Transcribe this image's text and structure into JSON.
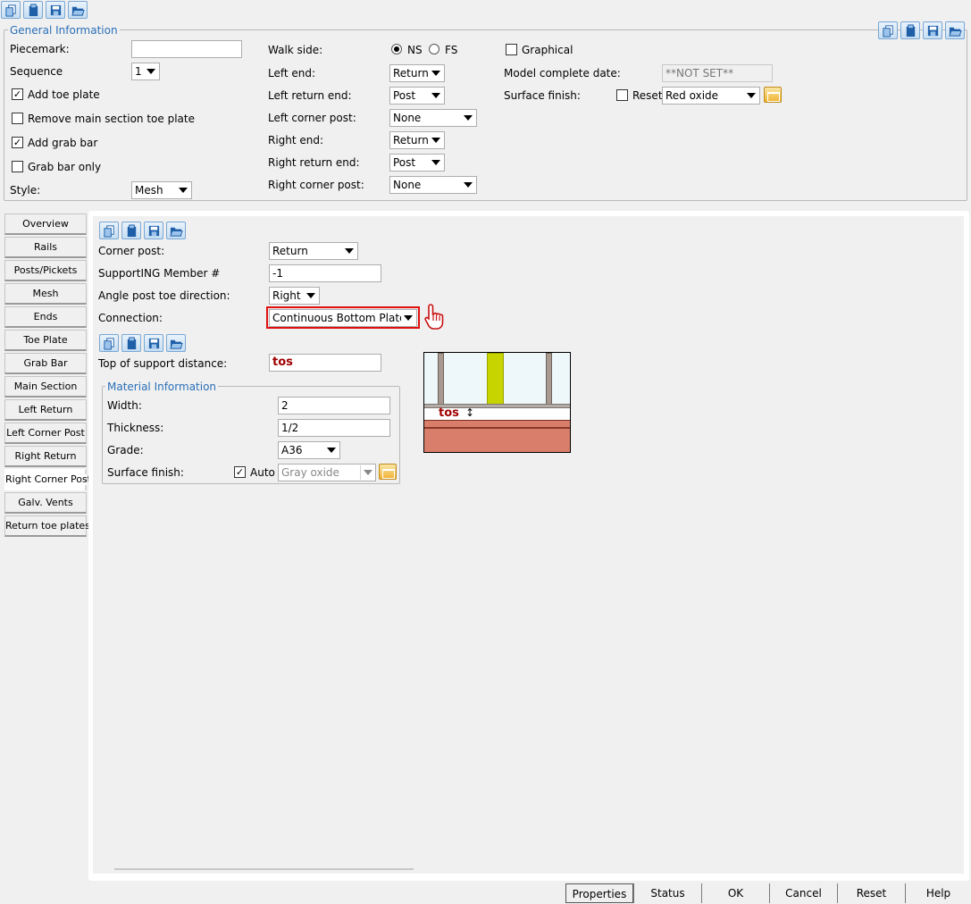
{
  "toolbar_icons": [
    "copy-icon",
    "clipboard-icon",
    "save-icon",
    "folder-open-icon"
  ],
  "general": {
    "legend": "General Information",
    "piecemark_label": "Piecemark:",
    "piecemark_value": "",
    "sequence_label": "Sequence",
    "sequence_value": "1",
    "add_toe_plate_label": "Add toe plate",
    "add_toe_plate_checked": true,
    "remove_main_toe_label": "Remove main section toe plate",
    "remove_main_toe_checked": false,
    "add_grab_bar_label": "Add grab bar",
    "add_grab_bar_checked": true,
    "grab_bar_only_label": "Grab bar only",
    "grab_bar_only_checked": false,
    "style_label": "Style:",
    "style_value": "Mesh",
    "walk_side_label": "Walk side:",
    "walk_side_ns": "NS",
    "walk_side_fs": "FS",
    "walk_side_selected": "NS",
    "left_end_label": "Left end:",
    "left_end_value": "Return",
    "left_return_end_label": "Left return end:",
    "left_return_end_value": "Post",
    "left_corner_post_label": "Left corner post:",
    "left_corner_post_value": "None",
    "right_end_label": "Right end:",
    "right_end_value": "Return",
    "right_return_end_label": "Right return end:",
    "right_return_end_value": "Post",
    "right_corner_post_label": "Right corner post:",
    "right_corner_post_value": "None",
    "graphical_label": "Graphical",
    "graphical_checked": false,
    "model_complete_label": "Model complete date:",
    "model_complete_value": "**NOT SET**",
    "surface_finish_label": "Surface finish:",
    "reset_label": "Reset",
    "reset_checked": false,
    "surface_finish_value": "Red oxide"
  },
  "tabs": [
    {
      "label": "Overview",
      "active": false
    },
    {
      "label": "Rails",
      "active": false
    },
    {
      "label": "Posts/Pickets",
      "active": false
    },
    {
      "label": "Mesh",
      "active": false
    },
    {
      "label": "Ends",
      "active": false
    },
    {
      "label": "Toe Plate",
      "active": false
    },
    {
      "label": "Grab Bar",
      "active": false
    },
    {
      "label": "Main Section",
      "active": false
    },
    {
      "label": "Left Return",
      "active": false
    },
    {
      "label": "Left Corner Post",
      "active": false
    },
    {
      "label": "Right Return",
      "active": false
    },
    {
      "label": "Right Corner Post",
      "active": true
    },
    {
      "label": "Galv. Vents",
      "active": false
    },
    {
      "label": "Return toe plates",
      "active": false
    }
  ],
  "panel": {
    "corner_post_label": "Corner post:",
    "corner_post_value": "Return",
    "supporting_member_label": "SupportING Member #",
    "supporting_member_value": "-1",
    "angle_toe_label": "Angle post toe direction:",
    "angle_toe_value": "Right",
    "connection_label": "Connection:",
    "connection_value": "Continuous Bottom Plate",
    "tos_label": "Top of support distance:",
    "tos_value": "tos",
    "diagram_label": "tos",
    "material": {
      "legend": "Material Information",
      "width_label": "Width:",
      "width_value": "2",
      "thickness_label": "Thickness:",
      "thickness_value": "1/2",
      "grade_label": "Grade:",
      "grade_value": "A36",
      "surface_finish_label": "Surface finish:",
      "auto_label": "Auto",
      "auto_checked": true,
      "surface_finish_value": "Gray oxide"
    }
  },
  "buttons": {
    "properties": "Properties",
    "status": "Status",
    "ok": "OK",
    "cancel": "Cancel",
    "reset": "Reset",
    "help": "Help"
  },
  "colors": {
    "accent": "#2a6fb8",
    "highlight": "#e01010",
    "tos_text": "#a00000",
    "post_yellow": "#c8d400",
    "concrete": "#d87e6a"
  }
}
